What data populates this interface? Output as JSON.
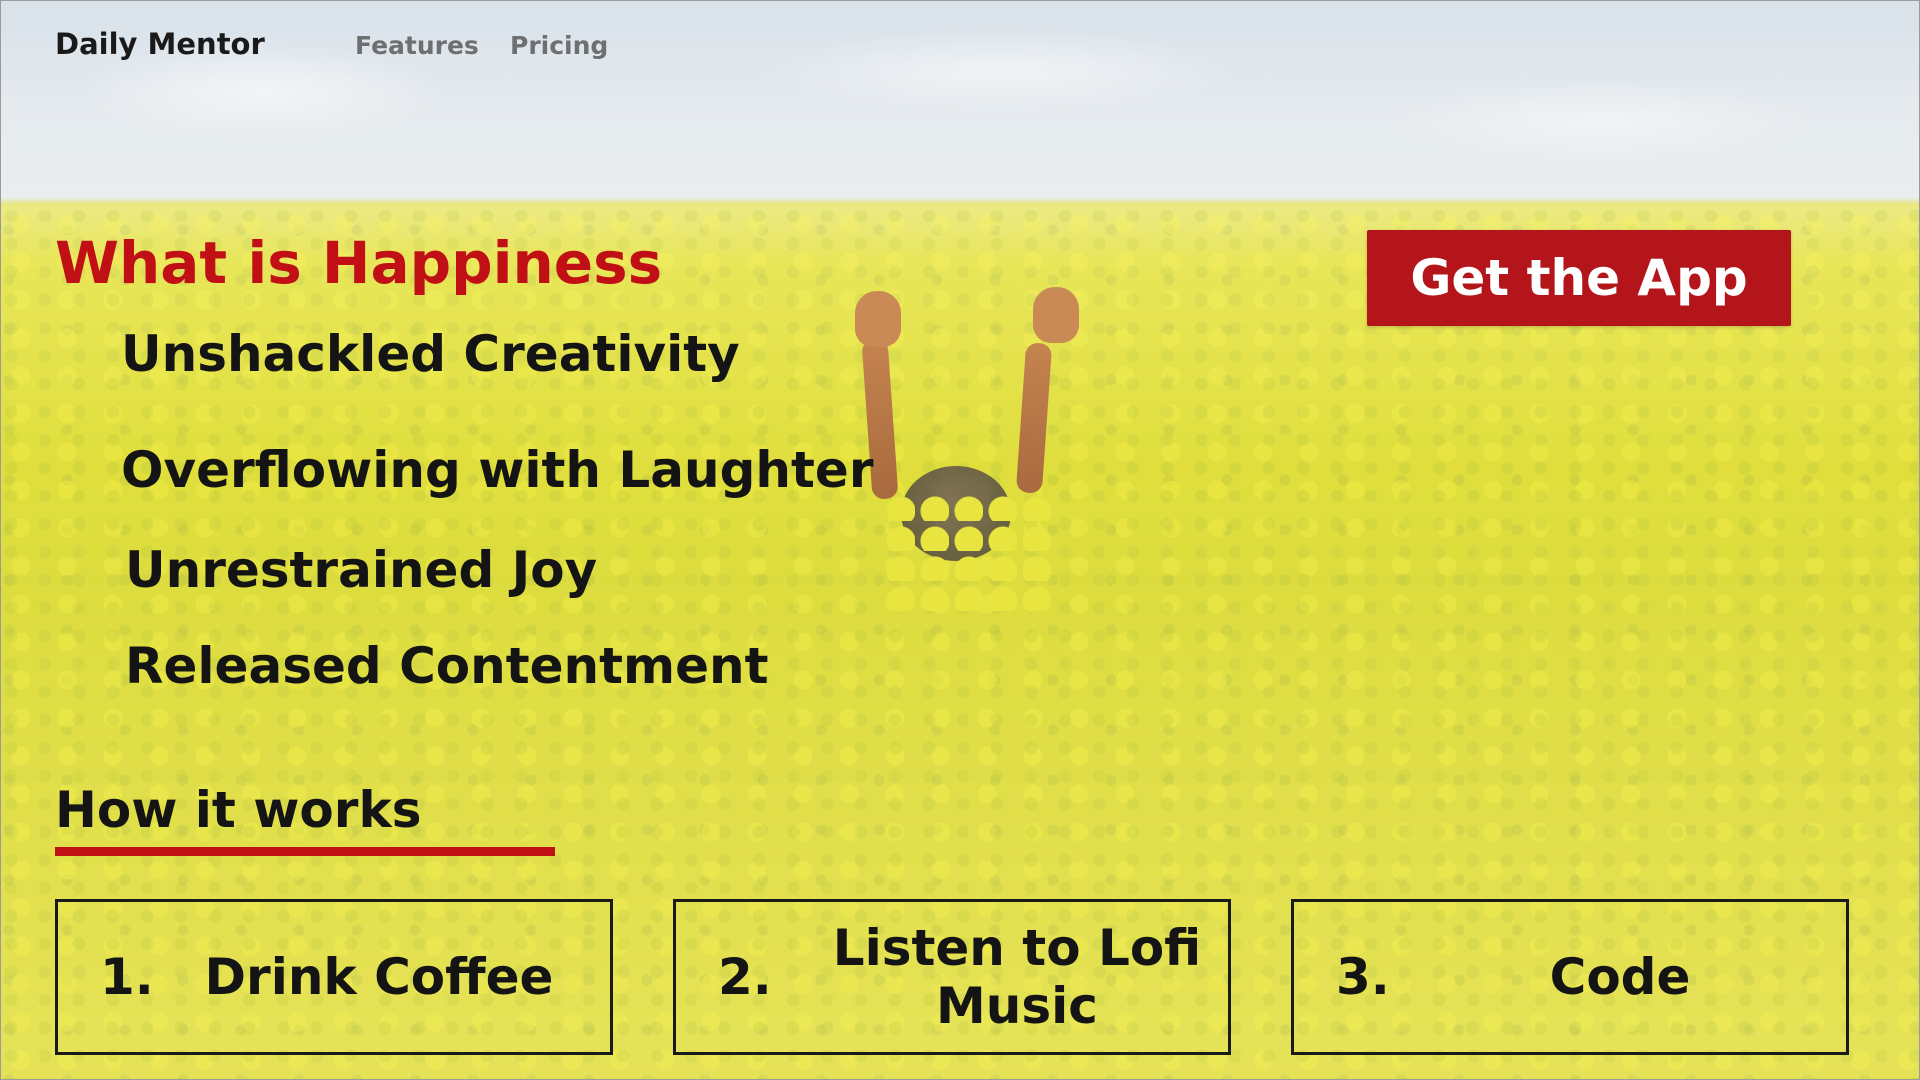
{
  "nav": {
    "brand": "Daily Mentor",
    "links": [
      "Features",
      "Pricing"
    ]
  },
  "hero": {
    "title": "What is Happiness",
    "items": [
      "Unshackled Creativity",
      "Overflowing with Laughter",
      "Unrestrained Joy",
      "Released Contentment"
    ],
    "cta_label": "Get the App"
  },
  "how_it_works": {
    "heading": "How it works",
    "steps": [
      {
        "number": "1.",
        "text": "Drink Coffee"
      },
      {
        "number": "2.",
        "text": "Listen to Lofi Music"
      },
      {
        "number": "3.",
        "text": "Code"
      }
    ]
  },
  "colors": {
    "accent": "#c01016",
    "button_bg": "#b3151b",
    "text": "#141414",
    "nav_link": "#6d6f71"
  }
}
